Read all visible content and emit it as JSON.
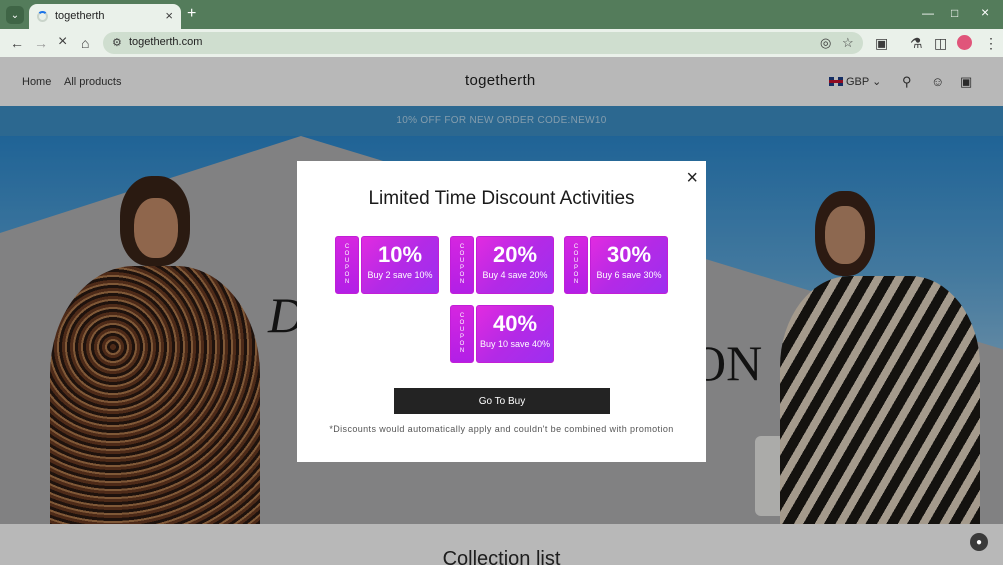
{
  "browser": {
    "tab_title": "togetherth",
    "url": "togetherth.com"
  },
  "header": {
    "nav": [
      "Home",
      "All products"
    ],
    "logo": "togetherth",
    "currency": "GBP"
  },
  "announcement": "10% OFF FOR NEW ORDER CODE:NEW10",
  "hero": {
    "left_text": "D",
    "right_text": "ON"
  },
  "section_title": "Collection list",
  "modal": {
    "title": "Limited Time Discount Activities",
    "coupons": [
      {
        "stub": [
          "C",
          "O",
          "U",
          "P",
          "O",
          "N"
        ],
        "percent": "10%",
        "desc": "Buy 2 save 10%"
      },
      {
        "stub": [
          "C",
          "O",
          "U",
          "P",
          "O",
          "N"
        ],
        "percent": "20%",
        "desc": "Buy 4 save 20%"
      },
      {
        "stub": [
          "C",
          "O",
          "U",
          "P",
          "O",
          "N"
        ],
        "percent": "30%",
        "desc": "Buy 6 save 30%"
      },
      {
        "stub": [
          "C",
          "O",
          "U",
          "P",
          "O",
          "N"
        ],
        "percent": "40%",
        "desc": "Buy 10 save 40%"
      }
    ],
    "button": "Go To Buy",
    "note": "*Discounts would automatically apply and couldn't be combined with promotion"
  },
  "icons": {
    "tab_search": "chevron-down-icon",
    "back": "arrow-left-icon",
    "forward": "arrow-right-icon",
    "stop": "close-icon",
    "home": "home-icon",
    "header_search": "search-icon",
    "account": "user-icon",
    "cart": "bag-icon"
  },
  "colors": {
    "tabbar": "#547c5b",
    "announcement_bg": "#3e91c8",
    "coupon": "#b42ae6",
    "button": "#232323"
  }
}
